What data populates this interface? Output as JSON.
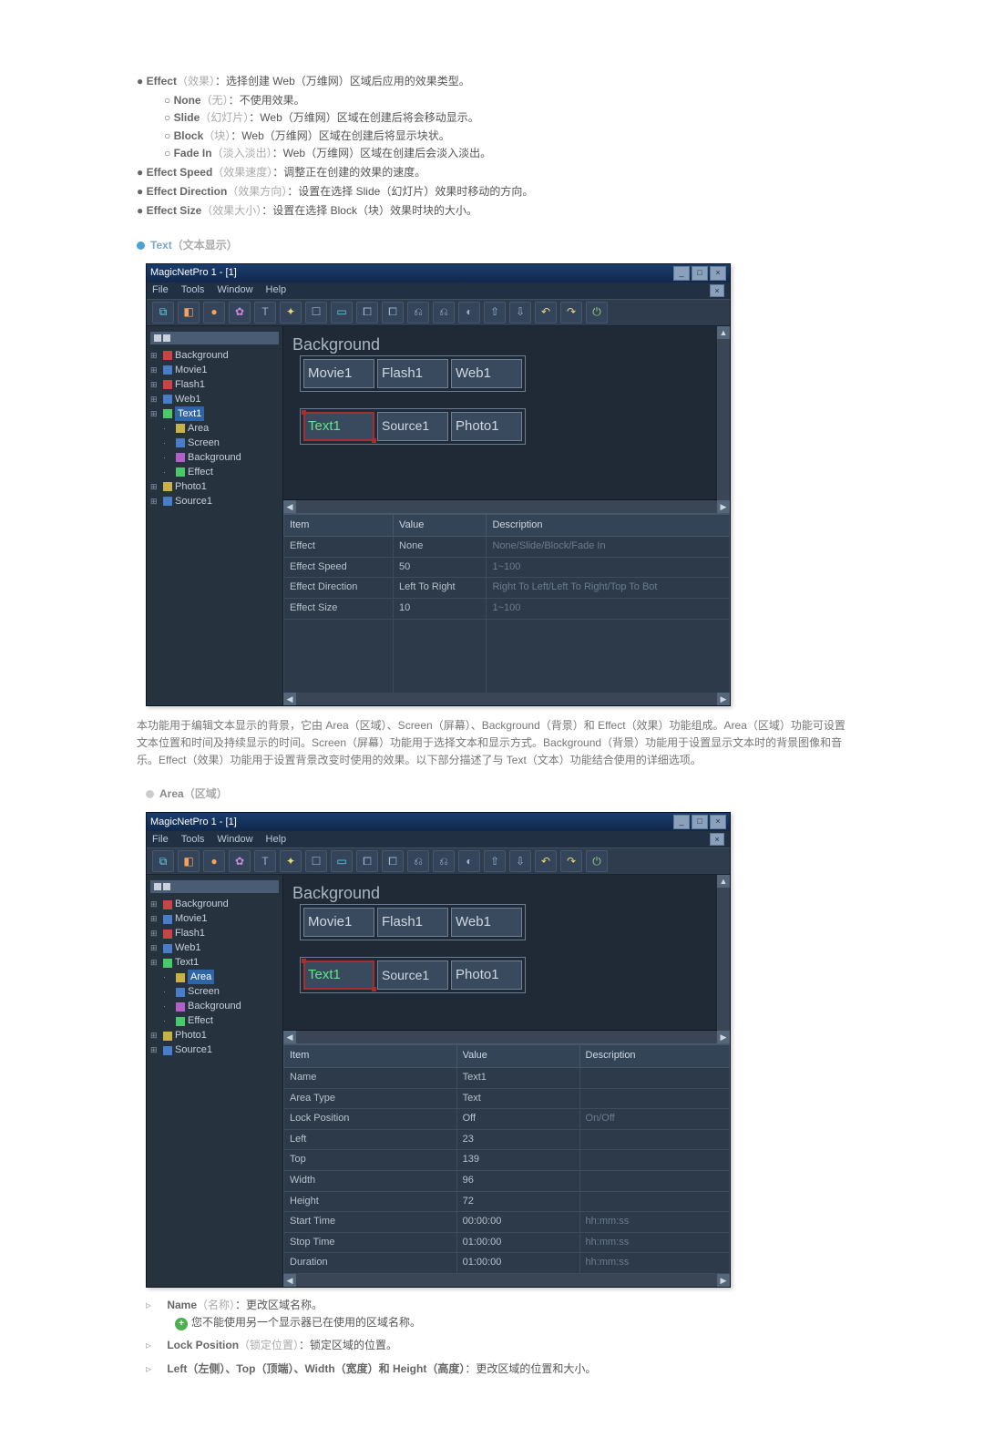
{
  "top_bullets": [
    {
      "lead": "Effect",
      "lead_gray": "（效果）",
      "rest": "：选择创建 Web（万维网）区域后应用的效果类型。"
    },
    {
      "lead": "Effect Speed",
      "lead_gray": "（效果速度）",
      "rest": "：调整正在创建的效果的速度。"
    },
    {
      "lead": "Effect Direction",
      "lead_gray": "（效果方向）",
      "rest": "：设置在选择 Slide（幻灯片）效果时移动的方向。"
    },
    {
      "lead": "Effect Size",
      "lead_gray": "（效果大小）",
      "rest": "：设置在选择 Block（块）效果时块的大小。"
    }
  ],
  "effect_sub": [
    {
      "lead": "None",
      "lead_gray": "（无）",
      "rest": "：不使用效果。"
    },
    {
      "lead": "Slide",
      "lead_gray": "（幻灯片）",
      "rest": "：Web（万维网）区域在创建后将会移动显示。"
    },
    {
      "lead": "Block",
      "lead_gray": "（块）",
      "rest": "：Web（万维网）区域在创建后将显示块状。"
    },
    {
      "lead": "Fade In",
      "lead_gray": "（淡入淡出）",
      "rest": "：Web（万维网）区域在创建后会淡入淡出。"
    }
  ],
  "section_text": {
    "label": "Text",
    "suffix": "（文本显示）"
  },
  "section_area": {
    "label": "Area",
    "suffix": "（区域）"
  },
  "para_text": "本功能用于编辑文本显示的背景，它由 Area（区域）、Screen（屏幕）、Background（背景）和 Effect（效果）功能组成。Area（区域）功能可设置文本位置和时间及持续显示的时间。Screen（屏幕）功能用于选择文本和显示方式。Background（背景）功能用于设置显示文本时的背景图像和音乐。Effect（效果）功能用于设置背景改变时使用的效果。以下部分描述了与 Text（文本）功能结合使用的详细选项。",
  "bottom_list": [
    {
      "lead": "Name",
      "lead_gray": "（名称）",
      "rest": "：更改区域名称。",
      "note": "您不能使用另一个显示器已在使用的区域名称。"
    },
    {
      "lead": "Lock Position",
      "lead_gray": "（锁定位置）",
      "rest": "：锁定区域的位置。"
    },
    {
      "lead_combo": "Left（左侧）、Top（顶端）、Width（宽度）和 Height（高度）",
      "rest": "：更改区域的位置和大小。"
    }
  ],
  "app": {
    "title": "MagicNetPro 1 - [1]",
    "win_min": "_",
    "win_max": "□",
    "win_close": "×",
    "win_close2": "×",
    "menu": [
      "File",
      "Tools",
      "Window",
      "Help"
    ],
    "tree_common": [
      "Background",
      "Movie1",
      "Flash1",
      "Web1"
    ],
    "tree_text_children": [
      "Area",
      "Screen",
      "Background",
      "Effect"
    ],
    "tree_rest": [
      "Photo1",
      "Source1"
    ],
    "canvas_bg": "Background",
    "row1": [
      "Movie1",
      "Flash1",
      "Web1"
    ],
    "row2": [
      "Text1",
      "Source1",
      "Photo1"
    ],
    "grid_headers": [
      "Item",
      "Value",
      "Description"
    ]
  },
  "grid_text": {
    "rows": [
      {
        "item": "Effect",
        "value": "None",
        "desc": "None/Slide/Block/Fade In"
      },
      {
        "item": "Effect Speed",
        "value": "50",
        "desc": "1~100"
      },
      {
        "item": "Effect Direction",
        "value": "Left To Right",
        "desc": "Right To Left/Left To Right/Top To Bot"
      },
      {
        "item": "Effect Size",
        "value": "10",
        "desc": "1~100"
      }
    ],
    "tree_sel": "Text1"
  },
  "grid_area": {
    "rows": [
      {
        "item": "Name",
        "value": "Text1",
        "desc": ""
      },
      {
        "item": "Area Type",
        "value": "Text",
        "desc": ""
      },
      {
        "item": "Lock Position",
        "value": "Off",
        "desc": "On/Off"
      },
      {
        "item": "Left",
        "value": "23",
        "desc": ""
      },
      {
        "item": "Top",
        "value": "139",
        "desc": ""
      },
      {
        "item": "Width",
        "value": "96",
        "desc": ""
      },
      {
        "item": "Height",
        "value": "72",
        "desc": ""
      },
      {
        "item": "Start Time",
        "value": "00:00:00",
        "desc": "hh:mm:ss"
      },
      {
        "item": "Stop Time",
        "value": "01:00:00",
        "desc": "hh:mm:ss"
      },
      {
        "item": "Duration",
        "value": "01:00:00",
        "desc": "hh:mm:ss"
      }
    ],
    "tree_sel": "Area"
  }
}
